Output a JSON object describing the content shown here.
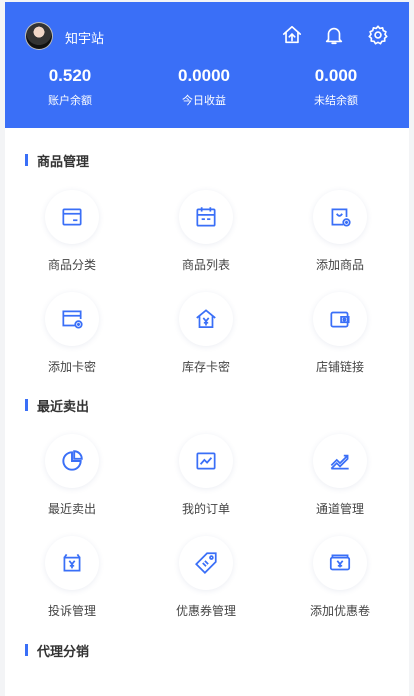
{
  "header": {
    "username": "知宇站",
    "background_color": "#3a6ff7",
    "icons": [
      "upload-icon",
      "bell-icon",
      "gear-icon"
    ],
    "stats": [
      {
        "value": "0.520",
        "label": "账户余额"
      },
      {
        "value": "0.0000",
        "label": "今日收益"
      },
      {
        "value": "0.000",
        "label": "未结余额"
      }
    ]
  },
  "sections": [
    {
      "title": "商品管理",
      "items": [
        {
          "label": "商品分类",
          "icon": "category-icon"
        },
        {
          "label": "商品列表",
          "icon": "list-icon"
        },
        {
          "label": "添加商品",
          "icon": "add-product-icon"
        },
        {
          "label": "添加卡密",
          "icon": "add-card-icon"
        },
        {
          "label": "库存卡密",
          "icon": "inventory-icon"
        },
        {
          "label": "店铺链接",
          "icon": "store-link-icon"
        }
      ]
    },
    {
      "title": "最近卖出",
      "items": [
        {
          "label": "最近卖出",
          "icon": "pie-chart-icon"
        },
        {
          "label": "我的订单",
          "icon": "line-chart-icon"
        },
        {
          "label": "通道管理",
          "icon": "trend-icon"
        },
        {
          "label": "投诉管理",
          "icon": "complaint-icon"
        },
        {
          "label": "优惠券管理",
          "icon": "coupon-tag-icon"
        },
        {
          "label": "添加优惠卷",
          "icon": "add-coupon-icon"
        }
      ]
    },
    {
      "title": "代理分销",
      "items": []
    }
  ]
}
